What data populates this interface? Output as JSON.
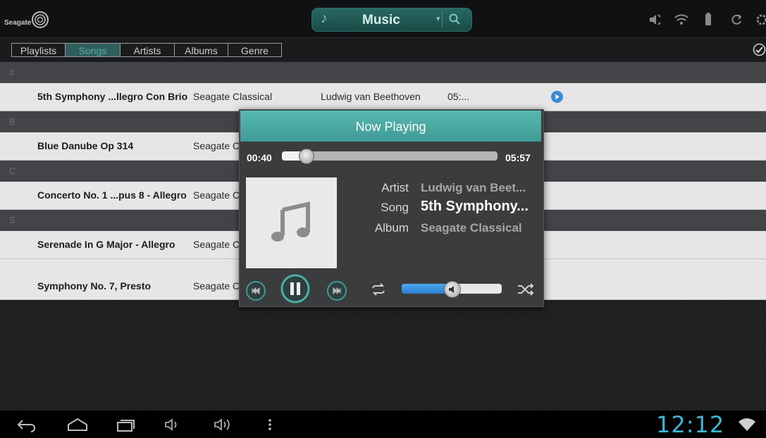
{
  "app": {
    "logo_text": "Seagate",
    "section_title": "Music"
  },
  "tabs": [
    {
      "label": "Playlists",
      "active": false
    },
    {
      "label": "Songs",
      "active": true
    },
    {
      "label": "Artists",
      "active": false
    },
    {
      "label": "Albums",
      "active": false
    },
    {
      "label": "Genre",
      "active": false
    }
  ],
  "sections": [
    {
      "letter": "#",
      "songs": [
        {
          "title": "5th Symphony ...llegro Con Brio",
          "album": "Seagate Classical",
          "artist": "Ludwig van Beethoven",
          "duration": "05:...",
          "playing": true
        }
      ]
    },
    {
      "letter": "B",
      "songs": [
        {
          "title": "Blue Danube Op 314",
          "album": "Seagate C"
        }
      ]
    },
    {
      "letter": "C",
      "songs": [
        {
          "title": "Concerto No. 1 ...pus 8 - Allegro",
          "album": "Seagate C"
        }
      ]
    },
    {
      "letter": "S",
      "songs": [
        {
          "title": "Serenade In G Major - Allegro",
          "album": "Seagate C"
        },
        {
          "title": "Symphony No. 7, Presto",
          "album": "Seagate C"
        }
      ]
    }
  ],
  "now_playing": {
    "title": "Now Playing",
    "elapsed": "00:40",
    "total": "05:57",
    "progress_fraction": 0.11,
    "artist_label": "Artist",
    "artist": "Ludwig van Beet...",
    "song_label": "Song",
    "song": "5th Symphony...",
    "album_label": "Album",
    "album": "Seagate Classical",
    "volume_fraction": 0.5
  },
  "status": {
    "clock": "12:12"
  },
  "colors": {
    "accent": "#4bb0a8",
    "clock": "#3fb6d8",
    "volume": "#2c7fd2"
  }
}
